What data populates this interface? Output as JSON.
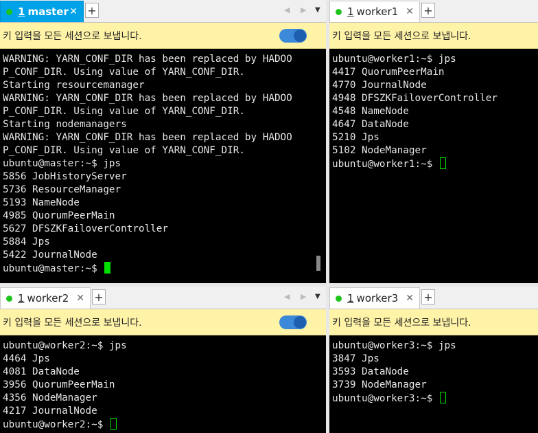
{
  "panes": {
    "master": {
      "tab_number": "1",
      "tab_name": "master",
      "close_icon": "✕",
      "plus_icon": "+",
      "broadcast_text": "키 입력을 모든 세션으로 보냅니다.",
      "lines": [
        "WARNING: YARN_CONF_DIR has been replaced by HADOO",
        "P_CONF_DIR. Using value of YARN_CONF_DIR.",
        "Starting resourcemanager",
        "WARNING: YARN_CONF_DIR has been replaced by HADOO",
        "P_CONF_DIR. Using value of YARN_CONF_DIR.",
        "Starting nodemanagers",
        "WARNING: YARN_CONF_DIR has been replaced by HADOO",
        "P_CONF_DIR. Using value of YARN_CONF_DIR.",
        "ubuntu@master:~$ jps",
        "5856 JobHistoryServer",
        "5736 ResourceManager",
        "5193 NameNode",
        "4985 QuorumPeerMain",
        "5627 DFSZKFailoverController",
        "5884 Jps",
        "5422 JournalNode"
      ],
      "prompt": "ubuntu@master:~$ "
    },
    "worker1": {
      "tab_number": "1",
      "tab_name": "worker1",
      "close_icon": "✕",
      "plus_icon": "+",
      "broadcast_text": "키 입력을 모든 세션으로 보냅니다.",
      "lines": [
        "ubuntu@worker1:~$ jps",
        "4417 QuorumPeerMain",
        "4770 JournalNode",
        "4948 DFSZKFailoverController",
        "4548 NameNode",
        "4647 DataNode",
        "5210 Jps",
        "5102 NodeManager"
      ],
      "prompt": "ubuntu@worker1:~$ "
    },
    "worker2": {
      "tab_number": "1",
      "tab_name": "worker2",
      "close_icon": "✕",
      "plus_icon": "+",
      "broadcast_text": "키 입력을 모든 세션으로 보냅니다.",
      "lines": [
        "ubuntu@worker2:~$ jps",
        "4464 Jps",
        "4081 DataNode",
        "3956 QuorumPeerMain",
        "4356 NodeManager",
        "4217 JournalNode"
      ],
      "prompt": "ubuntu@worker2:~$ "
    },
    "worker3": {
      "tab_number": "1",
      "tab_name": "worker3",
      "close_icon": "✕",
      "plus_icon": "+",
      "broadcast_text": "키 입력을 모든 세션으로 보냅니다.",
      "lines": [
        "ubuntu@worker3:~$ jps",
        "3847 Jps",
        "3593 DataNode",
        "3739 NodeManager"
      ],
      "prompt": "ubuntu@worker3:~$ "
    }
  },
  "nav_arrows": "◀ ▶",
  "dropdown_icon": "▼",
  "colors": {
    "active_tab": "#00a2e8",
    "status_dot": "#1ec31e",
    "broadcast_bg": "#fff3a8",
    "cursor": "#00e000"
  }
}
